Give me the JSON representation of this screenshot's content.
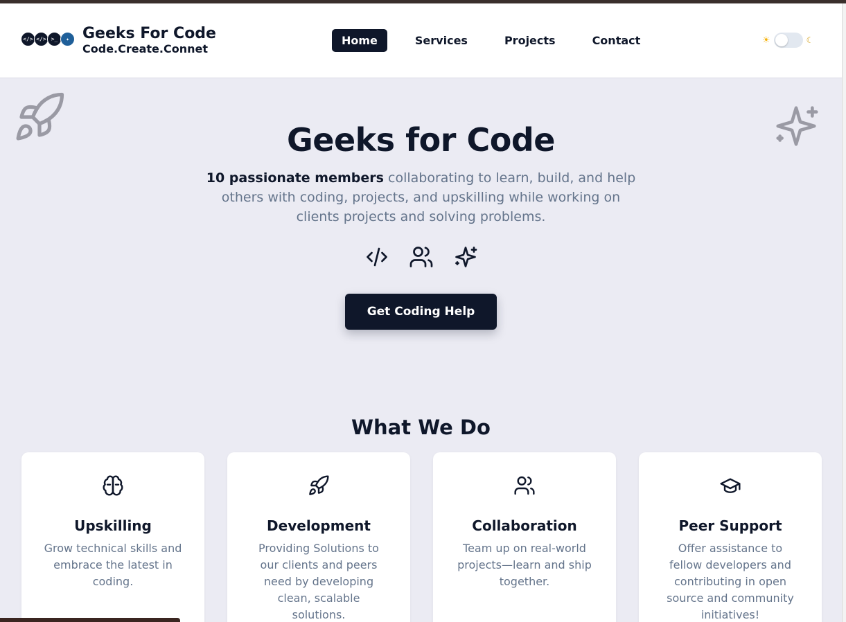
{
  "header": {
    "brand_title": "Geeks For Code",
    "brand_subtitle": "Code.Create.Connet",
    "nav": [
      "Home",
      "Services",
      "Projects",
      "Contact"
    ],
    "active_nav": "Home",
    "theme_toggle": {
      "light_icon": "sun-icon",
      "dark_icon": "moon-icon",
      "state": "light"
    }
  },
  "hero": {
    "title": "Geeks for Code",
    "highlight": "10 passionate members",
    "description": " collaborating to learn, build, and help others with coding, projects, and upskilling while working on clients projects and solving problems.",
    "icons": [
      "code-icon",
      "users-icon",
      "sparkles-icon"
    ],
    "cta_label": "Get Coding Help"
  },
  "services": {
    "title": "What We Do",
    "cards": [
      {
        "icon": "brain-icon",
        "title": "Upskilling",
        "text": "Grow technical skills and embrace the latest in coding."
      },
      {
        "icon": "rocket-icon",
        "title": "Development",
        "text": "Providing Solutions to our clients and peers need by developing clean, scalable solutions."
      },
      {
        "icon": "users-icon",
        "title": "Collaboration",
        "text": "Team up on real-world projects—learn and ship together."
      },
      {
        "icon": "graduation-cap-icon",
        "title": "Peer Support",
        "text": "Offer assistance to fellow developers and contributing in open source and community initiatives!"
      }
    ]
  },
  "colors": {
    "primary": "#0f172a",
    "background": "#ebebf3",
    "muted_text": "#64748b",
    "card": "#ffffff"
  }
}
